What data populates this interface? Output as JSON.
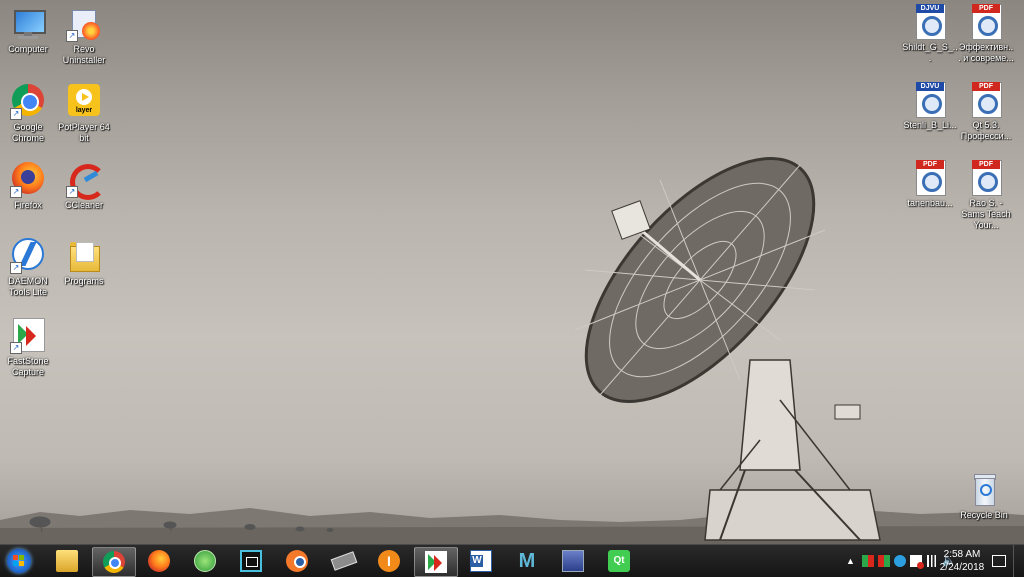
{
  "desktop_icons_left": [
    {
      "label": "Computer"
    },
    {
      "label": "Revo Uninstaller"
    },
    {
      "label": "Google Chrome"
    },
    {
      "label": "PotPlayer 64 bit"
    },
    {
      "label": "Firefox"
    },
    {
      "label": "CCleaner"
    },
    {
      "label": "DAEMON Tools Lite"
    },
    {
      "label": "Programs"
    },
    {
      "label": "FastStone Capture"
    }
  ],
  "desktop_icons_right": [
    {
      "label": "Shildt_G_S_...",
      "tag": "DJVU"
    },
    {
      "label": "Эффективн... и совреме...",
      "tag": "PDF"
    },
    {
      "label": "Stenli_B_Li...",
      "tag": "DJVU"
    },
    {
      "label": "Qt 5.3. Професси...",
      "tag": "PDF"
    },
    {
      "label": "tanenbau...",
      "tag": "PDF"
    },
    {
      "label": "Rao S. - Sams Teach Your...",
      "tag": "PDF"
    }
  ],
  "recycle_bin": {
    "label": "Recycle Bin"
  },
  "potplayer_badge": "layer",
  "taskbar": {
    "pinned": [
      {
        "name": "explorer"
      },
      {
        "name": "chrome"
      },
      {
        "name": "firefox"
      },
      {
        "name": "network-tool"
      },
      {
        "name": "video-editor"
      },
      {
        "name": "blender"
      },
      {
        "name": "chip-tool"
      },
      {
        "name": "info-tool"
      },
      {
        "name": "faststone"
      },
      {
        "name": "word"
      },
      {
        "name": "maya"
      },
      {
        "name": "calculator"
      },
      {
        "name": "qt-creator"
      }
    ],
    "clock": {
      "time": "2:58 AM",
      "date": "2/24/2018"
    }
  },
  "colors": {
    "taskbar": "#151515",
    "djvu_tag": "#1f4aa6",
    "pdf_tag": "#d0281f",
    "chrome_red": "#db4437",
    "chrome_yellow": "#f4b400",
    "chrome_green": "#0f9d58",
    "chrome_blue": "#4285f4"
  }
}
